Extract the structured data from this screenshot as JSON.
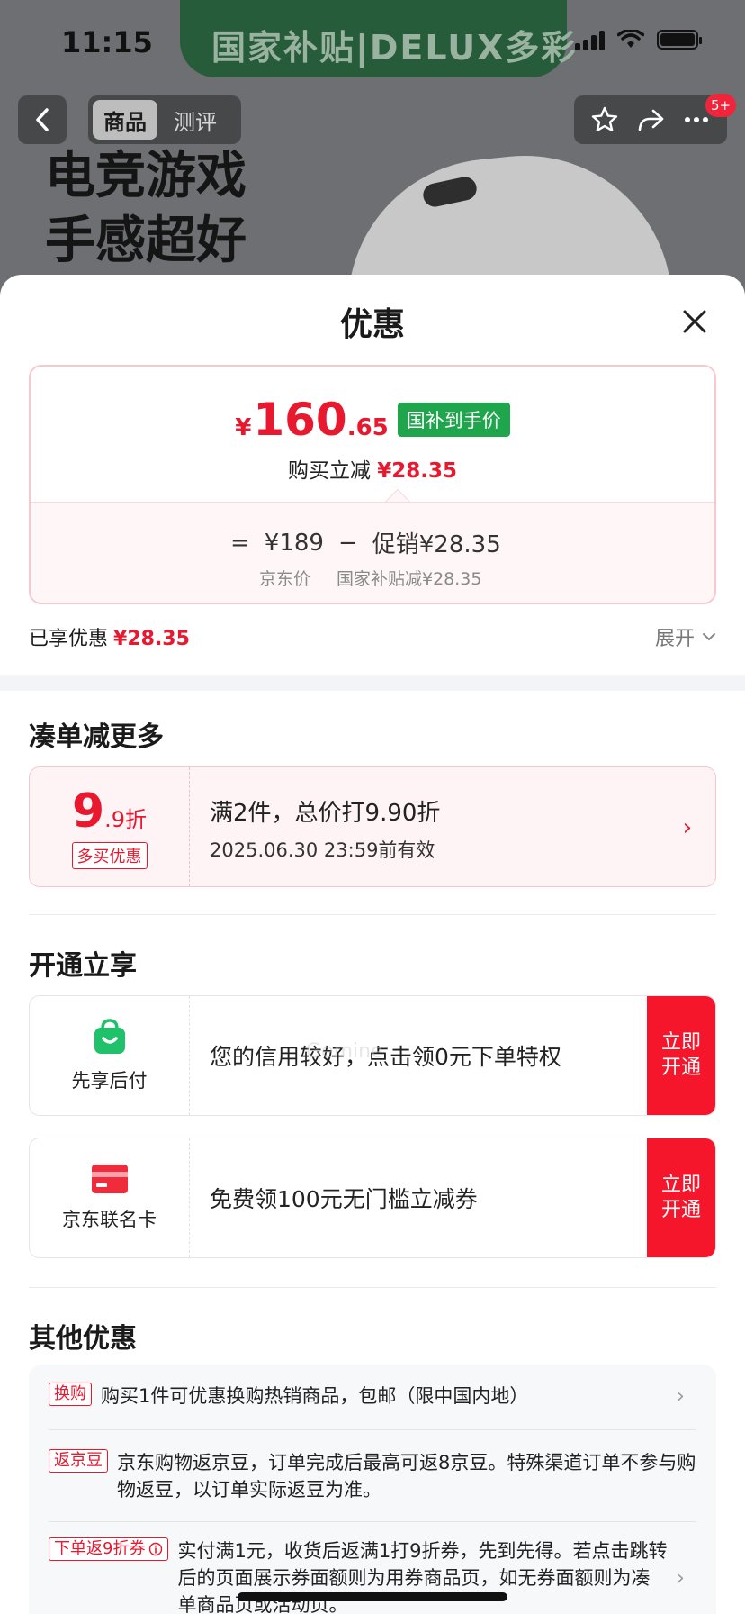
{
  "status_bar": {
    "time": "11:15"
  },
  "hero": {
    "banner_text": "国家补贴|DELUX多彩",
    "slogan_line1": "电竞游戏",
    "slogan_line2": "手感超好"
  },
  "nav": {
    "tabs": [
      {
        "label": "商品"
      },
      {
        "label": "测评"
      }
    ],
    "badge": "5+"
  },
  "sheet": {
    "title": "优惠",
    "price_card": {
      "currency": "¥",
      "price_int": "160",
      "price_dec": ".65",
      "tag": "国补到手价",
      "reduce_label": "购买立减",
      "reduce_amount": "¥28.35",
      "eq": "=",
      "jd_price": "¥189",
      "minus": "−",
      "promo": "促销¥28.35",
      "jd_price_label": "京东价",
      "promo_label": "国家补贴减¥28.35"
    },
    "enjoyed_label": "已享优惠",
    "enjoyed_amount": "¥28.35",
    "expand_label": "展开"
  },
  "section_combine": {
    "title": "凑单减更多",
    "deal": {
      "num_big": "9",
      "num_small": ".9折",
      "tag": "多买优惠",
      "text": "满2件，总价打9.90折",
      "valid": "2025.06.30 23:59前有效"
    }
  },
  "section_open": {
    "title": "开通立享",
    "items": [
      {
        "label": "先享后付",
        "text": "您的信用较好，点击领0元下单特权",
        "button": "立即开通",
        "icon_color": "#1fc26b"
      },
      {
        "label": "京东联名卡",
        "text": "免费领100元无门槛立减券",
        "button": "立即开通",
        "icon_color": "#ef2b3c"
      }
    ]
  },
  "section_other": {
    "title": "其他优惠",
    "items": [
      {
        "tag": "换购",
        "text": "购买1件可优惠换购热销商品，包邮（限中国内地）"
      },
      {
        "tag": "返京豆",
        "text": "京东购物返京豆，订单完成后最高可返8京豆。特殊渠道订单不参与购物返豆，以订单实际返豆为准。"
      },
      {
        "tag": "下单返9折券",
        "text": "实付满1元，收货后返满1打9折券，先到先得。若点击跳转后的页面展示券面额则为用券商品页，如无券面额则为凑单商品页或活动页。"
      }
    ]
  },
  "watermark": "Gemine",
  "colors": {
    "brand_red": "#e8182f",
    "tag_green": "#1fa64c",
    "button_red": "#f5162c"
  }
}
